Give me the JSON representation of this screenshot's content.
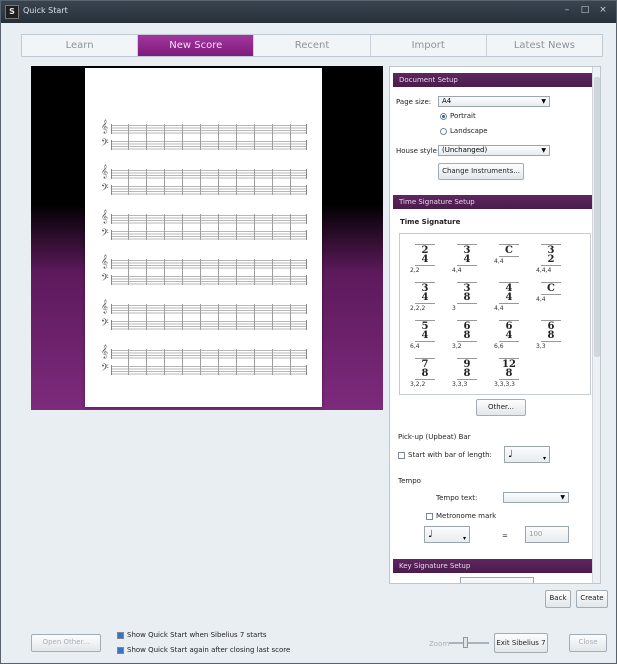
{
  "window": {
    "title": "Quick Start",
    "app_icon": "sibelius-icon",
    "controls": [
      "–",
      "□",
      "×"
    ]
  },
  "tabs": [
    {
      "label": "Learn",
      "active": false
    },
    {
      "label": "New Score",
      "active": true
    },
    {
      "label": "Recent",
      "active": false
    },
    {
      "label": "Import",
      "active": false
    },
    {
      "label": "Latest News",
      "active": false
    }
  ],
  "document_setup": {
    "header": "Document Setup",
    "page_size_label": "Page size:",
    "page_size_value": "A4",
    "orientation": {
      "portrait": "Portrait",
      "landscape": "Landscape",
      "selected": "portrait"
    },
    "house_style_label": "House style",
    "house_style_value": "(Unchanged)",
    "change_instruments": "Change Instruments..."
  },
  "time_signature_setup": {
    "header": "Time Signature Setup",
    "label": "Time Signature",
    "options": [
      {
        "num": "2",
        "den": "4",
        "beams": "2,2"
      },
      {
        "num": "3",
        "den": "4",
        "beams": "4,4"
      },
      {
        "num": "C",
        "den": "",
        "beams": "4,4"
      },
      {
        "num": "3",
        "den": "2",
        "beams": "4,4,4"
      },
      {
        "num": "3",
        "den": "4",
        "beams": "2,2,2"
      },
      {
        "num": "3",
        "den": "8",
        "beams": "3"
      },
      {
        "num": "4",
        "den": "4",
        "beams": "4,4"
      },
      {
        "num": "C",
        "den": "",
        "beams": "4,4"
      },
      {
        "num": "5",
        "den": "4",
        "beams": "6,4"
      },
      {
        "num": "6",
        "den": "8",
        "beams": "3,2"
      },
      {
        "num": "6",
        "den": "4",
        "beams": "6,6"
      },
      {
        "num": "6",
        "den": "8",
        "beams": "3,3"
      },
      {
        "num": "7",
        "den": "8",
        "beams": "3,2,2"
      },
      {
        "num": "9",
        "den": "8",
        "beams": "3,3,3"
      },
      {
        "num": "12",
        "den": "8",
        "beams": "3,3,3,3"
      }
    ],
    "other_button": "Other..."
  },
  "pickup_bar": {
    "label": "Pick-up (Upbeat) Bar",
    "checkbox_label": "Start with bar of length:",
    "checked": false,
    "note_value": "♩"
  },
  "tempo": {
    "label": "Tempo",
    "tempo_text_label": "Tempo text:",
    "tempo_text_value": "",
    "metronome_label": "Metronome mark",
    "metronome_checked": false,
    "note_value": "♩",
    "equals": "=",
    "bpm": "100"
  },
  "key_signature_setup": {
    "header": "Key Signature Setup"
  },
  "nav": {
    "back": "Back",
    "create": "Create"
  },
  "footer": {
    "open_other": "Open Other...",
    "show_on_start": "Show Quick Start when Sibelius 7 starts",
    "show_after_close": "Show Quick Start again after closing last score",
    "show_on_start_checked": true,
    "show_after_close_checked": true,
    "zoom_label": "Zoom",
    "exit": "Exit Sibelius 7",
    "close": "Close"
  },
  "colors": {
    "accent": "#8a2488",
    "header_bar": "#5e2660"
  }
}
